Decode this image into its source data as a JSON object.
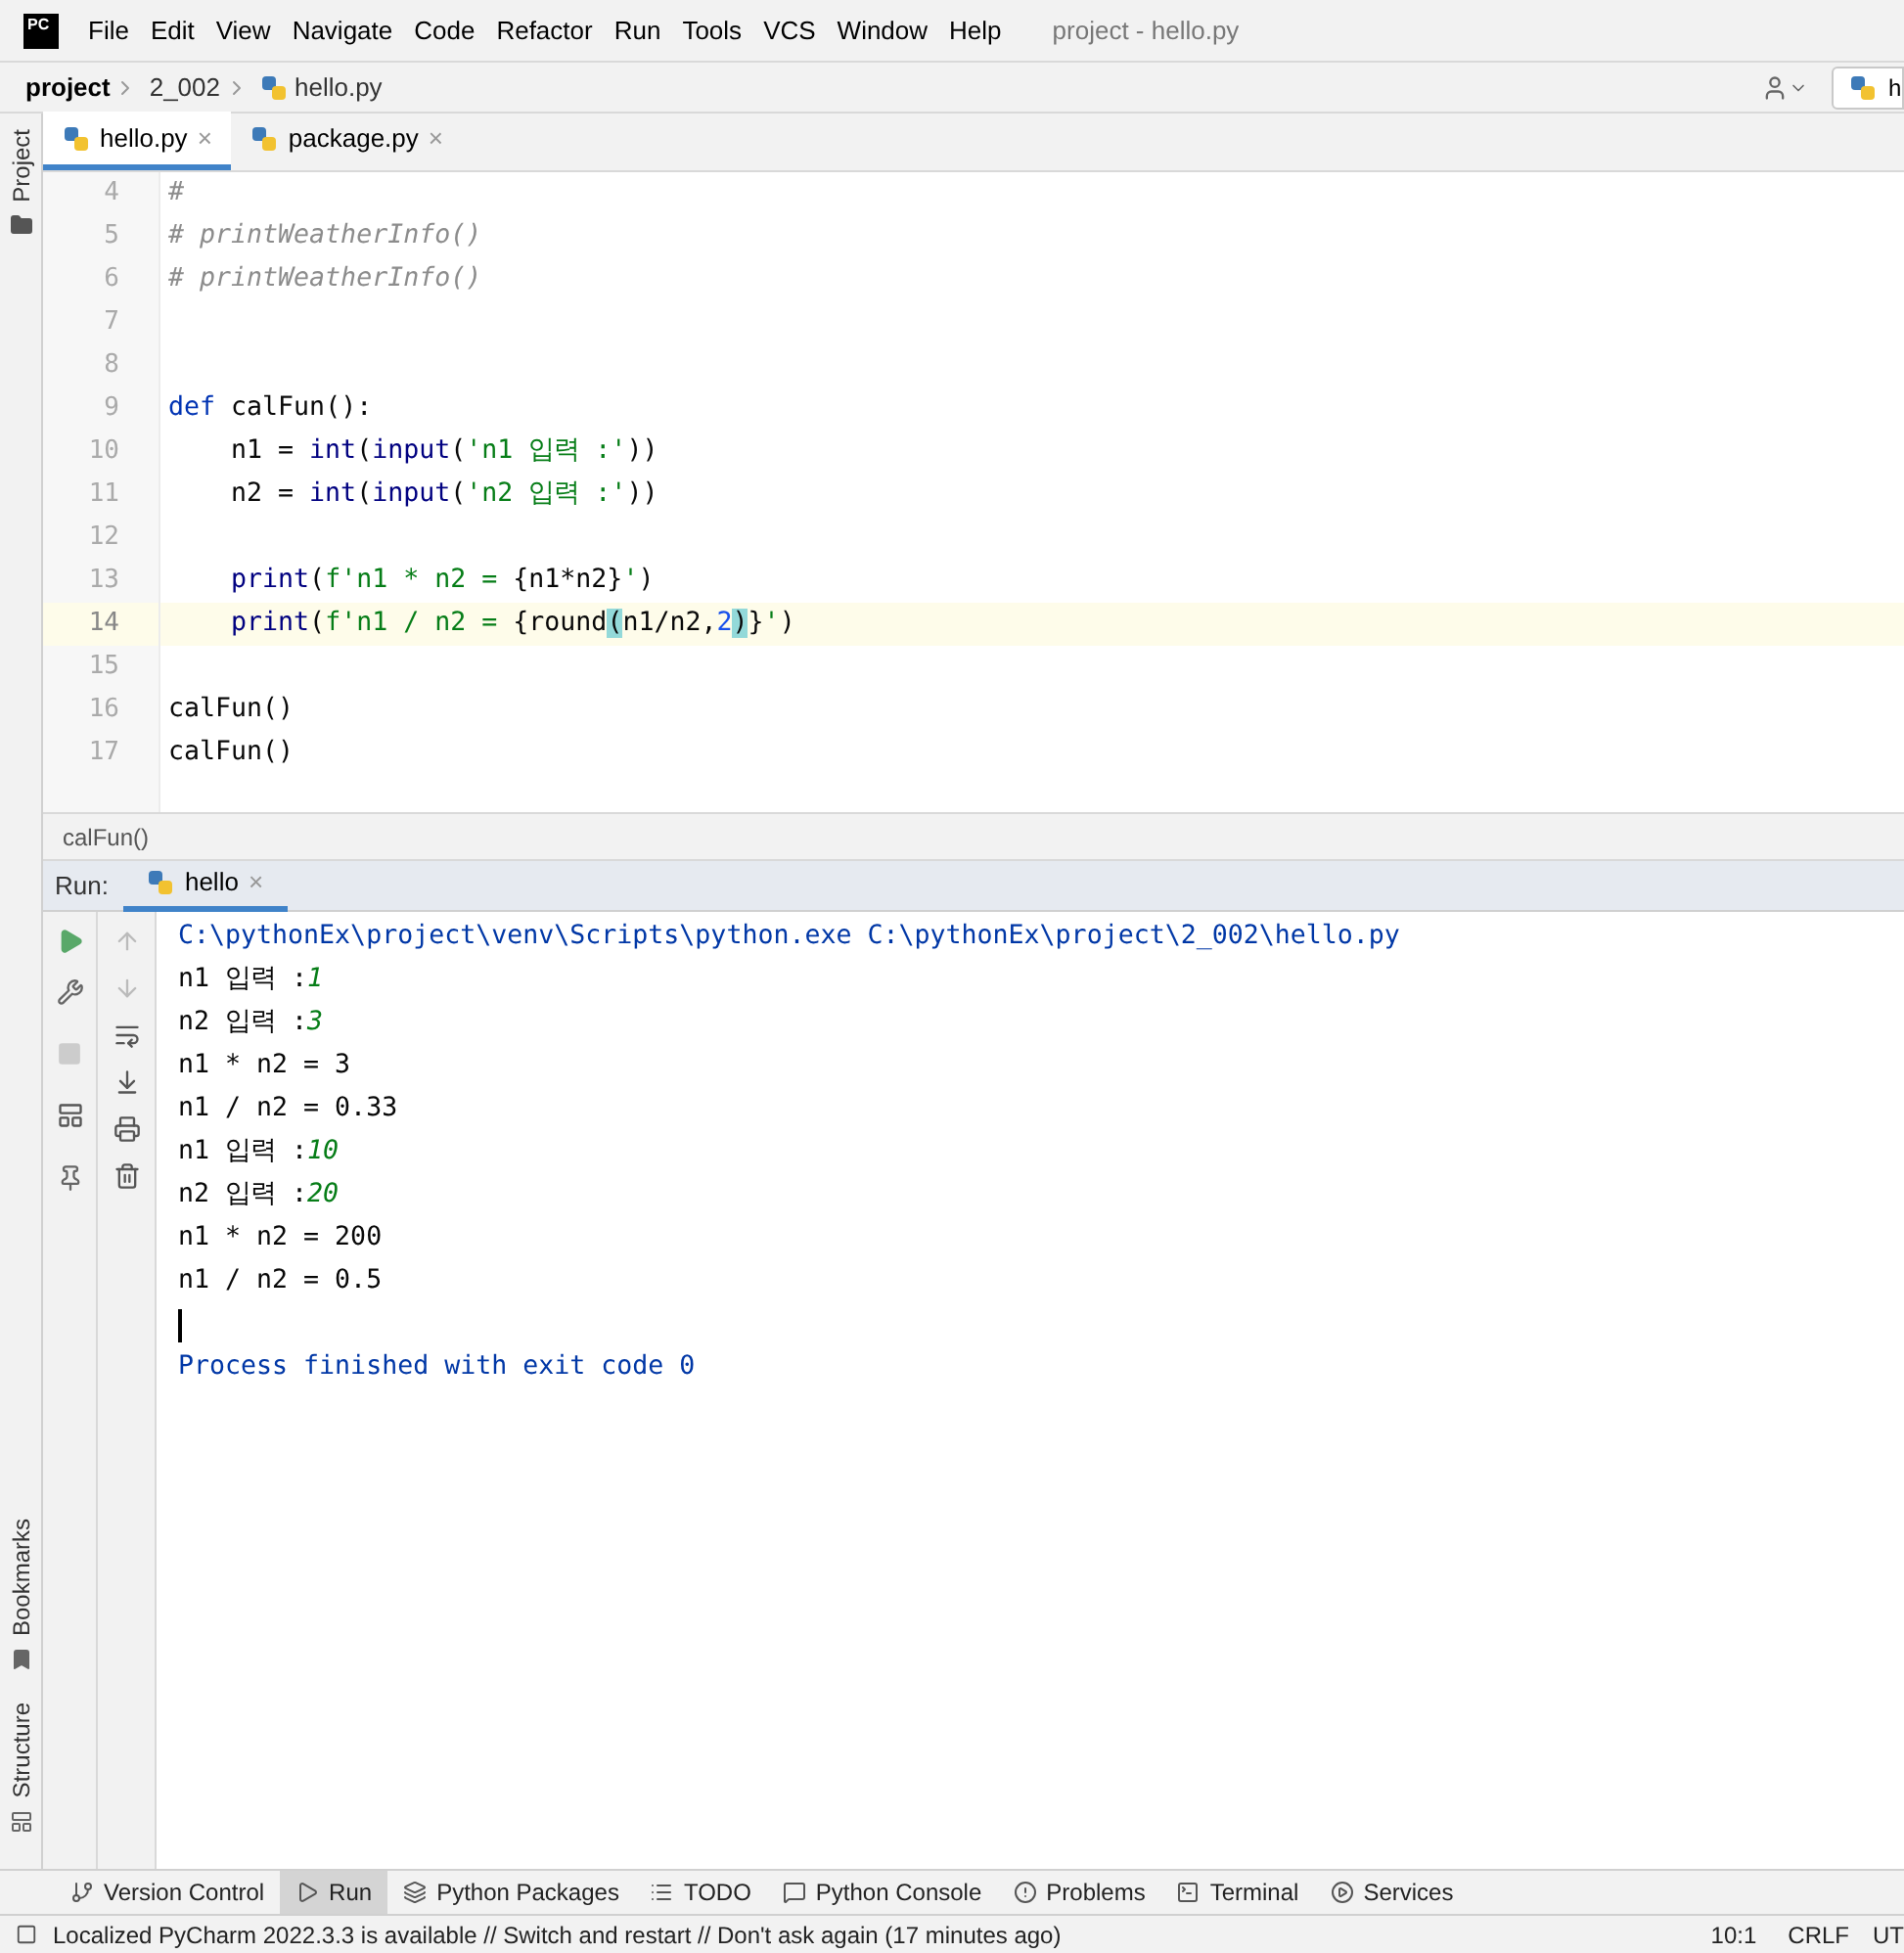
{
  "menu_bar": {
    "logo": "PC",
    "items": [
      "File",
      "Edit",
      "View",
      "Navigate",
      "Code",
      "Refactor",
      "Run",
      "Tools",
      "VCS",
      "Window",
      "Help"
    ],
    "title": "project - hello.py"
  },
  "breadcrumb": {
    "items": [
      "project",
      "2_002",
      "hello.py"
    ],
    "run_config": "h"
  },
  "left_tool_strip": {
    "top": [
      "Project"
    ],
    "bottom": [
      "Bookmarks",
      "Structure"
    ]
  },
  "editor_tabs": [
    {
      "label": "hello.py",
      "selected": true,
      "close": "×"
    },
    {
      "label": "package.py",
      "selected": false,
      "close": "×"
    }
  ],
  "editor": {
    "lines": [
      {
        "number": "4",
        "current": false,
        "tokens": [
          {
            "kind": "comment_plain",
            "text": "#"
          }
        ]
      },
      {
        "number": "5",
        "current": false,
        "tokens": [
          {
            "kind": "comment",
            "text": "# printWeatherInfo()"
          }
        ]
      },
      {
        "number": "6",
        "current": false,
        "tokens": [
          {
            "kind": "comment",
            "text": "# printWeatherInfo()"
          }
        ]
      },
      {
        "number": "7",
        "current": false
      },
      {
        "number": "8",
        "current": false
      },
      {
        "number": "9",
        "current": false,
        "tokens": [
          {
            "kind": "keyword",
            "text": "def "
          },
          {
            "kind": "plain",
            "text": "calFun():"
          }
        ]
      },
      {
        "number": "10",
        "current": false,
        "indented": true,
        "tokens": [
          {
            "kind": "plain",
            "text": "n1 = "
          },
          {
            "kind": "builtin",
            "text": "int"
          },
          {
            "kind": "plain",
            "text": "("
          },
          {
            "kind": "builtin",
            "text": "input"
          },
          {
            "kind": "plain",
            "text": "("
          },
          {
            "kind": "string",
            "text": "'n1 입력 :'"
          },
          {
            "kind": "plain",
            "text": "))"
          }
        ]
      },
      {
        "number": "11",
        "current": false,
        "indented": true,
        "tokens": [
          {
            "kind": "plain",
            "text": "n2 = "
          },
          {
            "kind": "builtin",
            "text": "int"
          },
          {
            "kind": "plain",
            "text": "("
          },
          {
            "kind": "builtin",
            "text": "input"
          },
          {
            "kind": "plain",
            "text": "("
          },
          {
            "kind": "string",
            "text": "'n2 입력 :'"
          },
          {
            "kind": "plain",
            "text": "))"
          }
        ]
      },
      {
        "number": "12",
        "current": false
      },
      {
        "number": "13",
        "current": false,
        "indented": true,
        "tokens": [
          {
            "kind": "builtin",
            "text": "print"
          },
          {
            "kind": "plain",
            "text": "("
          },
          {
            "kind": "string",
            "text": "f'n1 * n2 = "
          },
          {
            "kind": "plain",
            "text": "{n1*n2}"
          },
          {
            "kind": "string",
            "text": "'"
          },
          {
            "kind": "plain",
            "text": ")"
          }
        ]
      },
      {
        "number": "14",
        "current": true,
        "indented": true,
        "tokens": [
          {
            "kind": "builtin",
            "text": "print"
          },
          {
            "kind": "plain",
            "text": "("
          },
          {
            "kind": "string",
            "text": "f'n1 / n2 = "
          },
          {
            "kind": "plain",
            "text": "{round"
          },
          {
            "kind": "match",
            "text": "("
          },
          {
            "kind": "plain",
            "text": "n1/n2,"
          },
          {
            "kind": "number",
            "text": "2"
          },
          {
            "kind": "match",
            "text": ")"
          },
          {
            "kind": "plain",
            "text": "}"
          },
          {
            "kind": "string",
            "text": "'"
          },
          {
            "kind": "plain",
            "text": ")"
          }
        ]
      },
      {
        "number": "15",
        "current": false
      },
      {
        "number": "16",
        "current": false,
        "tokens": [
          {
            "kind": "plain",
            "text": "calFun()"
          }
        ]
      },
      {
        "number": "17",
        "current": false,
        "tokens": [
          {
            "kind": "plain",
            "text": "calFun()"
          }
        ]
      }
    ],
    "breadcrumb": "calFun()"
  },
  "run_panel": {
    "label": "Run:",
    "tabs": [
      {
        "label": "hello",
        "selected": true,
        "close": "×"
      }
    ],
    "console": [
      [
        {
          "kind": "system",
          "text": "C:\\pythonEx\\project\\venv\\Scripts\\python.exe C:\\pythonEx\\project\\2_002\\hello.py"
        }
      ],
      [
        {
          "kind": "output",
          "text": "n1 입력 :"
        },
        {
          "kind": "input",
          "text": "1"
        }
      ],
      [
        {
          "kind": "output",
          "text": "n2 입력 :"
        },
        {
          "kind": "input",
          "text": "3"
        }
      ],
      [
        {
          "kind": "output",
          "text": "n1 * n2 = 3"
        }
      ],
      [
        {
          "kind": "output",
          "text": "n1 / n2 = 0.33"
        }
      ],
      [
        {
          "kind": "output",
          "text": "n1 입력 :"
        },
        {
          "kind": "input",
          "text": "10"
        }
      ],
      [
        {
          "kind": "output",
          "text": "n2 입력 :"
        },
        {
          "kind": "input",
          "text": "20"
        }
      ],
      [
        {
          "kind": "output",
          "text": "n1 * n2 = 200"
        }
      ],
      [
        {
          "kind": "output",
          "text": "n1 / n2 = 0.5"
        }
      ],
      [
        {
          "kind": "caret"
        }
      ],
      [
        {
          "kind": "system",
          "text": "Process finished with exit code 0"
        }
      ]
    ]
  },
  "tool_windows": [
    {
      "kind": "vcs",
      "label": "Version Control",
      "selected": false
    },
    {
      "kind": "run",
      "label": "Run",
      "selected": true
    },
    {
      "kind": "packages",
      "label": "Python Packages",
      "selected": false
    },
    {
      "kind": "todo",
      "label": "TODO",
      "selected": false
    },
    {
      "kind": "console",
      "label": "Python Console",
      "selected": false
    },
    {
      "kind": "problems",
      "label": "Problems",
      "selected": false
    },
    {
      "kind": "terminal",
      "label": "Terminal",
      "selected": false
    },
    {
      "kind": "services",
      "label": "Services",
      "selected": false
    }
  ],
  "status_bar": {
    "message": "Localized PyCharm 2022.3.3 is available // Switch and restart // Don't ask again (17 minutes ago)",
    "position": "10:1",
    "line_ending": "CRLF",
    "encoding": "UT"
  }
}
